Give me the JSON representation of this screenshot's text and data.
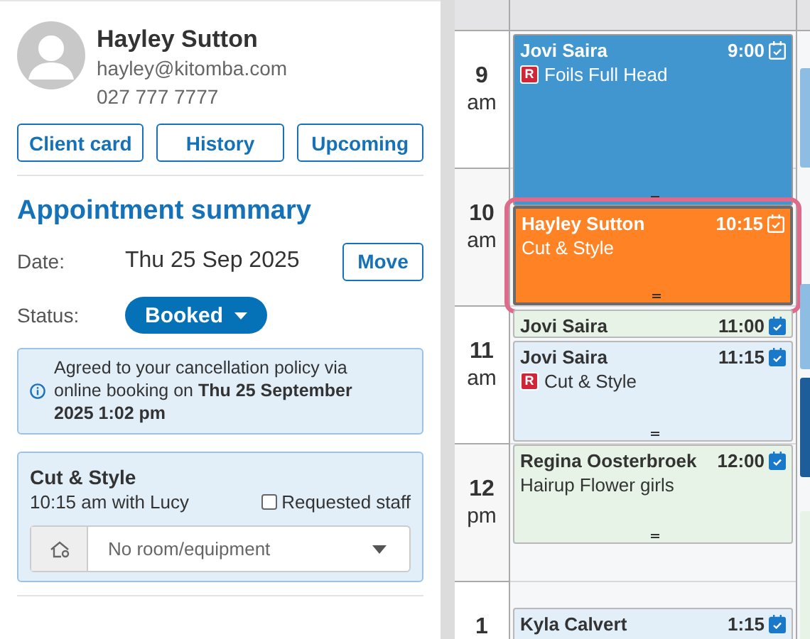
{
  "client": {
    "name": "Hayley Sutton",
    "email": "hayley@kitomba.com",
    "phone": "027 777 7777"
  },
  "client_buttons": [
    "Client card",
    "History",
    "Upcoming"
  ],
  "summary": {
    "title": "Appointment summary",
    "date_label": "Date:",
    "date": "Thu 25 Sep 2025",
    "move": "Move",
    "status_label": "Status:",
    "status": "Booked",
    "notice": "Agreed to your cancellation policy via online booking on **Thu 25 September 2025 1:02 pm**"
  },
  "service": {
    "name": "Cut & Style",
    "detail": "10:15 am with Lucy",
    "requested_label": "Requested staff",
    "requested": false,
    "room": {
      "placeholder": "No room/equipment"
    }
  },
  "hours": [
    {
      "hour": "9",
      "period": "am"
    },
    {
      "hour": "10",
      "period": "am"
    },
    {
      "hour": "11",
      "period": "am"
    },
    {
      "hour": "12",
      "period": "pm"
    },
    {
      "hour": "1"
    }
  ],
  "events": [
    {
      "client": "Jovi Saira",
      "time": "9:00",
      "service": "Foils Full Head",
      "badge": "R",
      "color": "#4196cf",
      "selected": false
    },
    {
      "client": "Hayley Sutton",
      "time": "10:15",
      "service": "Cut & Style",
      "color": "#ff8225",
      "selected": true
    },
    {
      "client": "Jovi Saira",
      "time": "11:00",
      "color": "#e6f3e6",
      "selected": false
    },
    {
      "client": "Jovi Saira",
      "time": "11:15",
      "service": "Cut & Style",
      "badge": "R",
      "color": "#e2eef8",
      "selected": false
    },
    {
      "client": "Regina Oosterbroek",
      "time": "12:00",
      "service": "Hairup Flower girls",
      "color": "#e6f3e6",
      "selected": false
    },
    {
      "client": "Kyla Calvert",
      "time": "1:15",
      "color": "#e2eef8",
      "selected": false
    }
  ],
  "side_events": [
    {
      "color": "#8dbde3"
    },
    {
      "color": "#8dbde3"
    },
    {
      "color": "#1d5e9a"
    },
    {
      "color": "#e6f3e6"
    }
  ]
}
